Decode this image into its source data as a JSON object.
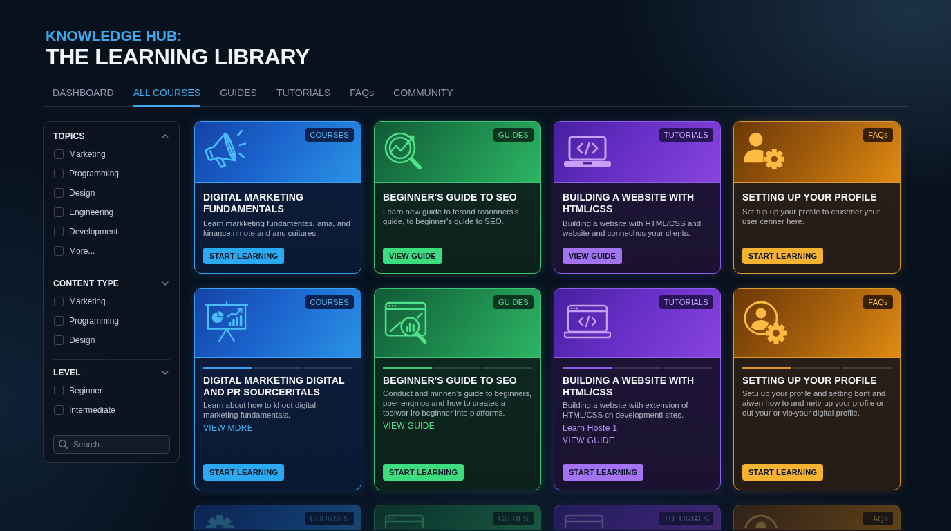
{
  "header": {
    "eyebrow": "KNOWLEDGE HUB:",
    "title": "THE LEARNING LIBRARY"
  },
  "tabs": [
    {
      "label": "DASHBOARD",
      "selected": false
    },
    {
      "label": "ALL COURSES",
      "selected": true
    },
    {
      "label": "GUIDES",
      "selected": false
    },
    {
      "label": "TUTORIALS",
      "selected": false
    },
    {
      "label": "FAQs",
      "selected": false
    },
    {
      "label": "COMMUNITY",
      "selected": false
    }
  ],
  "sidebar": {
    "sections": [
      {
        "title": "TOPICS",
        "expanded": true,
        "options": [
          {
            "label": "Marketing",
            "checked": false
          },
          {
            "label": "Programming",
            "checked": false
          },
          {
            "label": "Design",
            "checked": false
          },
          {
            "label": "Engineering",
            "checked": false
          },
          {
            "label": "Development",
            "checked": false
          },
          {
            "label": "More...",
            "checked": false
          }
        ]
      },
      {
        "title": "CONTENT TYPE",
        "expanded": false,
        "options": [
          {
            "label": "Marketing",
            "checked": false
          },
          {
            "label": "Programming",
            "checked": false
          },
          {
            "label": "Design",
            "checked": false
          }
        ]
      },
      {
        "title": "LEVEL",
        "expanded": false,
        "options": [
          {
            "label": "Beginner",
            "checked": false
          },
          {
            "label": "Intermediate",
            "checked": false
          }
        ]
      }
    ],
    "search": {
      "placeholder": "Search"
    }
  },
  "card_rows": [
    {
      "cards": [
        {
          "kind": "courses",
          "badge": "COURSES",
          "title": "DIGITAL MARKETING FUNDAMENTALS",
          "description": "Learn markketing fundamentas, ama, and kinance:nmote and anu cuitures.",
          "button": "START LEARNING"
        },
        {
          "kind": "guides",
          "badge": "GUIDES",
          "title": "BEGINNER'S GUIDE TO SEO",
          "description": "Learn new guide to terond reaonners's guide, to beginner's gulde to SEO.",
          "button": "VIEW GUIDE"
        },
        {
          "kind": "tutorials",
          "badge": "TUTORIALS",
          "title": "BUILDING A WEBSITE WITH HTML/CSS",
          "description": "Building a website with HTML/CSS and website and connechos your clients.",
          "button": "VIEW GUIDE"
        },
        {
          "kind": "faqs",
          "badge": "FAQs",
          "title": "SETTING UP YOUR PROFILE",
          "description": "Set tup up your profile to crustmer your user cenner here.",
          "button": "START LEARNING"
        }
      ]
    },
    {
      "cards": [
        {
          "kind": "courses",
          "badge": "COURSES",
          "progress": {
            "level": 0.33
          },
          "title": "DIGITAL MARKETING DIGITAL AND PR SOURCERITALS",
          "description": "Learn about how to khout digital marketing fundamentals.",
          "links": [
            "VIEW MDRE"
          ],
          "button": "START LEARNING"
        },
        {
          "kind": "guides",
          "badge": "GUIDES",
          "progress": {
            "level": 0.33
          },
          "title": "BEGINNER'S GUIDE TO SEO",
          "description": "Conduct and minnen’s guide to beginners, poer engmos and how to creates a toolwor iro beginner into platforms.",
          "links": [
            "VIEW GUIDE"
          ],
          "button": "START LEARNING"
        },
        {
          "kind": "tutorials",
          "badge": "TUTORIALS",
          "progress": {
            "level": 0.33
          },
          "title": "BUILDING A WEBSITE WITH HTML/CSS",
          "description": "Building a website with extension of HTML/CSS cn developmentl sites.",
          "links": [
            "Learn Hoste 1",
            "VIEW GUIDE"
          ],
          "button": "START LEARNING"
        },
        {
          "kind": "faqs",
          "badge": "FAQs",
          "progress": {
            "level": 0.33
          },
          "title": "SETTING UP YOUR PROFILE",
          "description": "Setu up your profile and setting bant and aiwen how to and netv-up your profile or out your or vip-your digital profile.",
          "button": "START LEARNING"
        }
      ]
    },
    {
      "cards": [
        {
          "kind": "courses",
          "badge": "COURSES"
        },
        {
          "kind": "guides",
          "badge": "GUIDES"
        },
        {
          "kind": "tutorials",
          "badge": "TUTORIALS"
        },
        {
          "kind": "faqs",
          "badge": "FAQs"
        }
      ]
    }
  ]
}
